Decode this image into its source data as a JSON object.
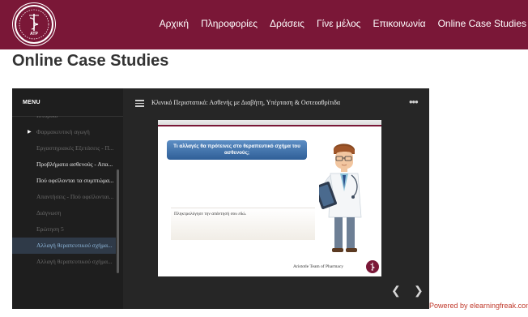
{
  "header": {
    "nav": [
      "Αρχική",
      "Πληροφορίες",
      "Δράσεις",
      "Γίνε μέλος",
      "Επικοινωνία",
      "Online Case Studies"
    ],
    "logo_text": "ATP"
  },
  "page_title": "Online Case Studies",
  "player": {
    "menu_label": "MENU",
    "course_title": "Κλινικό Περιστατικό: Ασθενής με Διαβήτη, Υπέρταση & Οστεοαθρίτιδα",
    "menu_items": [
      {
        "label": "Ιστορικό",
        "state": "dim"
      },
      {
        "label": "Φαρμακευτική αγωγή",
        "state": "dim"
      },
      {
        "label": "Εργαστηριακές Εξετάσεις - Π...",
        "state": "dim"
      },
      {
        "label": "Προβλήματα ασθενούς - Απα...",
        "state": "bright"
      },
      {
        "label": "Πού οφείλονται τα συμπτώμα...",
        "state": "bright"
      },
      {
        "label": "Απαντήσεις - Πού οφείλονται...",
        "state": "dim"
      },
      {
        "label": "Διάγνωση",
        "state": "dim"
      },
      {
        "label": "Ερώτηση 5",
        "state": "dim"
      },
      {
        "label": "Αλλαγή θεραπευτικού σχήμα...",
        "state": "active"
      },
      {
        "label": "Αλλαγή θεραπευτικού σχήμα...",
        "state": "dim"
      }
    ],
    "slide": {
      "question": "Τι αλλαγές θα πρότεινες στο θεραπευτικό σχήμα του ασθενούς;",
      "answer_placeholder": "Πληκτρολόγησε την απάντησή σου εδώ.",
      "footer": "Aristotle Team of Pharmacy"
    },
    "icons": {
      "hamburger": "hamburger-menu-icon",
      "more": "more-options-icon",
      "prev": "chevron-left-icon",
      "next": "chevron-right-icon"
    }
  },
  "powered_by": "Powered by elearningfreak.com",
  "colors": {
    "brand": "#7a1737",
    "player_bg": "#262626",
    "active_item": "#2f3a48",
    "question_box": "#2f5f98",
    "powered": "#c0392b"
  }
}
